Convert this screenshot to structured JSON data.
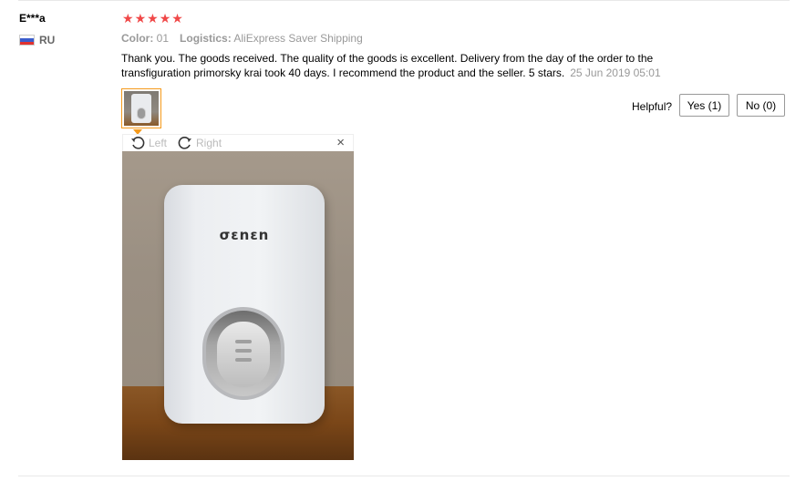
{
  "review": {
    "user_name": "E***a",
    "country_code": "RU",
    "rating": 5,
    "stars": [
      "★",
      "★",
      "★",
      "★",
      "★"
    ],
    "attributes": {
      "color_label": "Color:",
      "color_value": "01",
      "logistics_label": "Logistics:",
      "logistics_value": "AliExpress Saver Shipping"
    },
    "text": "Thank you. The goods received. The quality of the goods is excellent. Delivery from the day of the order to the transfiguration primorsky krai took 40 days. I recommend the product and the seller. 5 stars.",
    "date": "25 Jun 2019 05:01"
  },
  "helpful": {
    "label": "Helpful?",
    "yes_label": "Yes (1)",
    "no_label": "No (0)"
  },
  "image_viewer": {
    "rotate_left_label": "Left",
    "rotate_right_label": "Right",
    "close_symbol": "×",
    "brand_text": "σεnεn"
  },
  "icons": {
    "rotate_left": "rotate-left-icon",
    "rotate_right": "rotate-right-icon",
    "close": "close-icon",
    "flag": "russia-flag-icon",
    "star": "star-icon"
  },
  "colors": {
    "star": "#f04848",
    "thumb_border": "#f59a1b",
    "muted_text": "#999999"
  }
}
